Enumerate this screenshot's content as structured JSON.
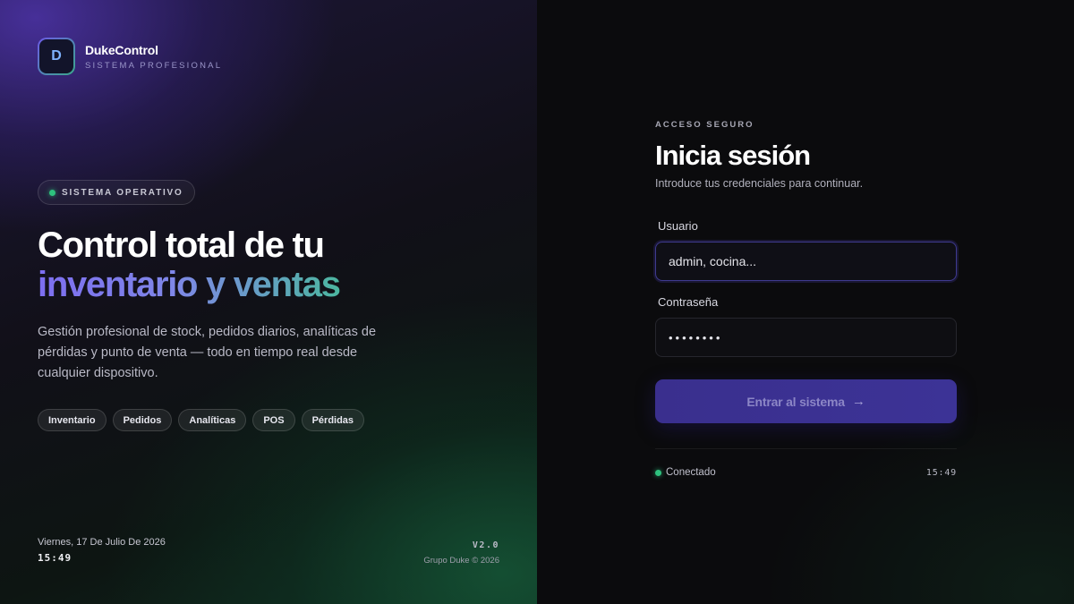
{
  "brand": {
    "logo_letter": "D",
    "name": "DukeControl",
    "subtitle": "SISTEMA PROFESIONAL"
  },
  "hero": {
    "status": "SISTEMA OPERATIVO",
    "headline_line1": "Control total de tu",
    "headline_line2": "inventario y ventas",
    "description": "Gestión profesional de stock, pedidos diarios, analíticas de pérdidas y punto de venta — todo en tiempo real desde cualquier dispositivo.",
    "tags": [
      "Inventario",
      "Pedidos",
      "Analíticas",
      "POS",
      "Pérdidas"
    ]
  },
  "footer_left": {
    "date": "Viernes, 17 De Julio De 2026",
    "time": "15:49",
    "version": "V2.0",
    "copyright": "Grupo Duke © 2026"
  },
  "login": {
    "eyebrow": "ACCESO SEGURO",
    "title": "Inicia sesión",
    "subtitle": "Introduce tus credenciales para continuar.",
    "username_label": "Usuario",
    "username_placeholder": "admin, cocina...",
    "password_label": "Contraseña",
    "password_value": "••••••••",
    "submit_label": "Entrar al sistema",
    "submit_icon": "arrow-right-icon",
    "connection_status": "Conectado",
    "clock": "15:49"
  },
  "colors": {
    "accent_purple": "#7d6ef0",
    "accent_teal": "#4cb6a0",
    "status_green": "#2ec27e",
    "button_bg": "#3a2f8e"
  }
}
